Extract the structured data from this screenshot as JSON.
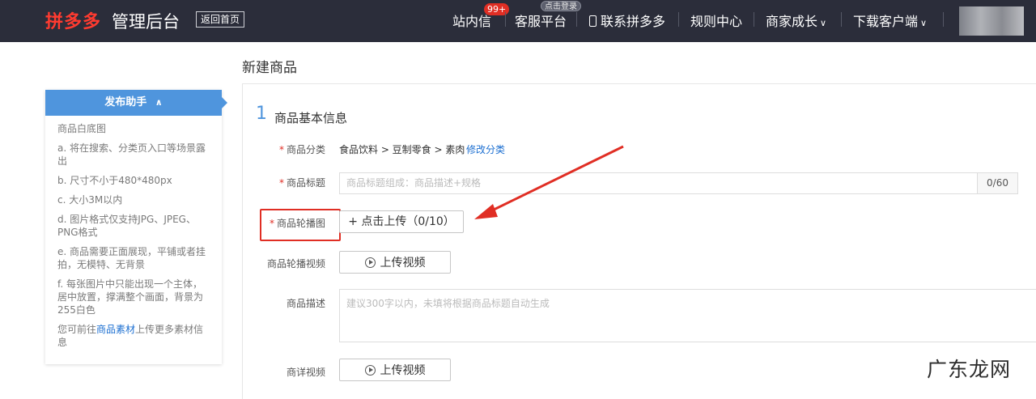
{
  "header": {
    "logo": "拼多多",
    "logo_sub": "管理后台",
    "home_button": "返回首页",
    "nav": {
      "inbox": "站内信",
      "inbox_badge": "99+",
      "service": "客服平台",
      "service_badge": "点击登录",
      "contact": "联系拼多多",
      "rules": "规则中心",
      "growth": "商家成长",
      "download": "下载客户端"
    }
  },
  "page": {
    "title": "新建商品"
  },
  "helper": {
    "title": "发布助手",
    "items": [
      "商品白底图",
      "a. 将在搜索、分类页入口等场景露出",
      "b. 尺寸不小于480*480px",
      "c. 大小3M以内",
      "d. 图片格式仅支持JPG、JPEG、PNG格式",
      "e. 商品需要正面展现，平铺或者挂拍，无模特、无背景",
      "f. 每张图片中只能出现一个主体，居中放置，撑满整个画面，背景为255白色"
    ],
    "footer_pre": "您可前往",
    "footer_link": "商品素材",
    "footer_post": "上传更多素材信息"
  },
  "form": {
    "section_num": "1",
    "section_title": "商品基本信息",
    "category_label": "商品分类",
    "category_value": "食品饮料 > 豆制零食 > 素肉",
    "category_edit": "修改分类",
    "title_label": "商品标题",
    "title_placeholder": "商品标题组成：商品描述+规格",
    "title_counter": "0/60",
    "carousel_label": "商品轮播图",
    "carousel_upload": "+ 点击上传（0/10）",
    "carousel_video_label": "商品轮播视频",
    "upload_video": "上传视频",
    "desc_label": "商品描述",
    "desc_placeholder": "建议300字以内，未填将根据商品标题自动生成",
    "detail_video_label": "商详视频"
  },
  "watermark": "广东龙网",
  "colors": {
    "topbar": "#2b2d3a",
    "brand_red": "#e02e24",
    "accent_blue": "#4f95dd"
  }
}
